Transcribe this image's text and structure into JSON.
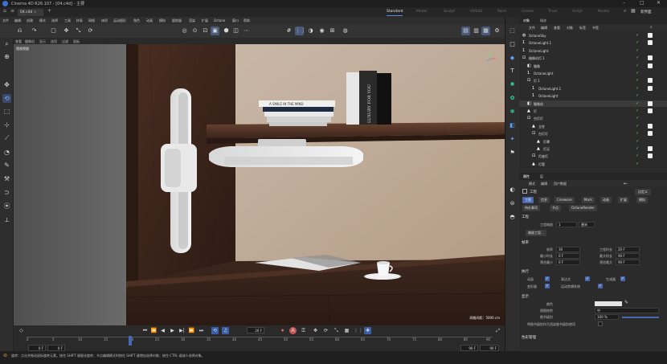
{
  "app": {
    "title": "Cinema 4D R26.107 - [04.c4d] - 主要",
    "doc_tab": "04.c4d",
    "win_controls": [
      "–",
      "□",
      "✕"
    ]
  },
  "modes": [
    "Standard",
    "Model",
    "Sculpt",
    "UVEdit",
    "Paint",
    "Groom",
    "Track",
    "Script",
    "Nodes"
  ],
  "active_mode": "Standard",
  "new_scene_label": "新界面",
  "menu": [
    "文件",
    "编辑",
    "创建",
    "模式",
    "选择",
    "工具",
    "样条",
    "网格",
    "体积",
    "运动图形",
    "角色",
    "动画",
    "模拟",
    "跟踪器",
    "渲染",
    "扩展",
    "Octane",
    "窗口",
    "帮助"
  ],
  "viewport": {
    "header_menu": [
      "查看",
      "摄像机",
      "显示",
      "选项",
      "过滤",
      "面板"
    ],
    "label": "透视视图",
    "grid_status": "网格间距：5000 cm",
    "book_spine": "LUXURY FOR YOU",
    "book_title": "A SMILE IN THE MIND"
  },
  "timeline": {
    "current_frame": "20 F",
    "ruler_ticks": [
      "0",
      "5",
      "10",
      "15",
      "20",
      "25",
      "30",
      "35",
      "40",
      "45",
      "50",
      "55",
      "60",
      "65",
      "70",
      "75",
      "80",
      "85",
      "90"
    ],
    "start": "0 F",
    "start2": "0 F",
    "end": "90 F",
    "end2": "90 F"
  },
  "status": {
    "message": "旋转：点击并拖动鼠标旋转元素。按住 SHIFT 键量化旋转；节点编辑模式时按住 SHIFT 键增加选择对象；按住 CTRL 键减少选择对象。"
  },
  "object_manager": {
    "tabs": [
      "对象",
      "场次"
    ],
    "menu": [
      "文件",
      "编辑",
      "查看",
      "对象",
      "标签",
      "书签"
    ],
    "rows": [
      {
        "name": "OctaneSky",
        "icon": "sky-icon",
        "indent": 0
      },
      {
        "name": "OctaneLight.1",
        "icon": "light-icon",
        "indent": 0
      },
      {
        "name": "OctaneLight",
        "icon": "light-icon",
        "indent": 0
      },
      {
        "name": "摄像机灯.1",
        "icon": "group-icon",
        "indent": 0
      },
      {
        "name": "摄像",
        "icon": "camera-icon",
        "indent": 1
      },
      {
        "name": "OctaneLight",
        "icon": "light-icon",
        "indent": 1
      },
      {
        "name": "灯.1",
        "icon": "group-icon",
        "indent": 1
      },
      {
        "name": "OctaneLight.1",
        "icon": "light-icon",
        "indent": 2
      },
      {
        "name": "OctaneLight",
        "icon": "light-icon",
        "indent": 2
      },
      {
        "name": "摄像机",
        "icon": "camera-icon",
        "indent": 1
      },
      {
        "name": "灯",
        "icon": "object-icon",
        "indent": 1
      },
      {
        "name": "台灯灯",
        "icon": "group-icon",
        "indent": 1
      },
      {
        "name": "立柱",
        "icon": "object-icon",
        "indent": 2
      },
      {
        "name": "台灯灯",
        "icon": "group-icon",
        "indent": 2
      },
      {
        "name": "灯罩",
        "icon": "object-icon",
        "indent": 3
      },
      {
        "name": "灯泛",
        "icon": "object-icon",
        "indent": 3
      },
      {
        "name": "灯座灯",
        "icon": "group-icon",
        "indent": 2
      },
      {
        "name": "灯管",
        "icon": "object-icon",
        "indent": 2
      }
    ]
  },
  "attribute_manager": {
    "tabs": [
      "属性",
      "层"
    ],
    "menu": [
      "模式",
      "编辑",
      "用户数据"
    ],
    "mode_value": "自定义",
    "title": "工程",
    "buttons": [
      "工程",
      "信息",
      "Cineware",
      "Mark",
      "动画",
      "扩展",
      "模拟",
      "待办事项",
      "节点",
      "OctaneRender"
    ],
    "section_project": "工程",
    "scale_label": "工程缩放",
    "scale_value": "1",
    "scale_unit": "厘米",
    "scale_button": "缩放工程...",
    "section_timing": "帧率",
    "fps_label": "帧率",
    "fps_value": "30",
    "project_time_label": "工程时长",
    "project_time_value": "20 F",
    "min_time_label": "最小时长",
    "min_time_value": "0 F",
    "max_time_label": "最大时长",
    "max_time_value": "90 F",
    "preview_min_label": "预览最小",
    "preview_min_value": "0 F",
    "preview_max_label": "预览最大",
    "preview_max_value": "90 F",
    "section_exec": "执行",
    "checks": [
      {
        "label": "动画",
        "on": true
      },
      {
        "label": "表达式",
        "on": true
      },
      {
        "label": "生成器",
        "on": true
      },
      {
        "label": "变形器",
        "on": true
      },
      {
        "label": "运动剪辑系统",
        "on": true
      }
    ],
    "section_display": "显示",
    "color_label": "颜色",
    "view_clip_label": "视图修剪",
    "view_clip_value": "中",
    "lod_label": "细节级别",
    "lod_value": "100 %",
    "render_lod_label": "将细节级别作为渲染细节级别使用",
    "section_color": "色彩管理"
  }
}
